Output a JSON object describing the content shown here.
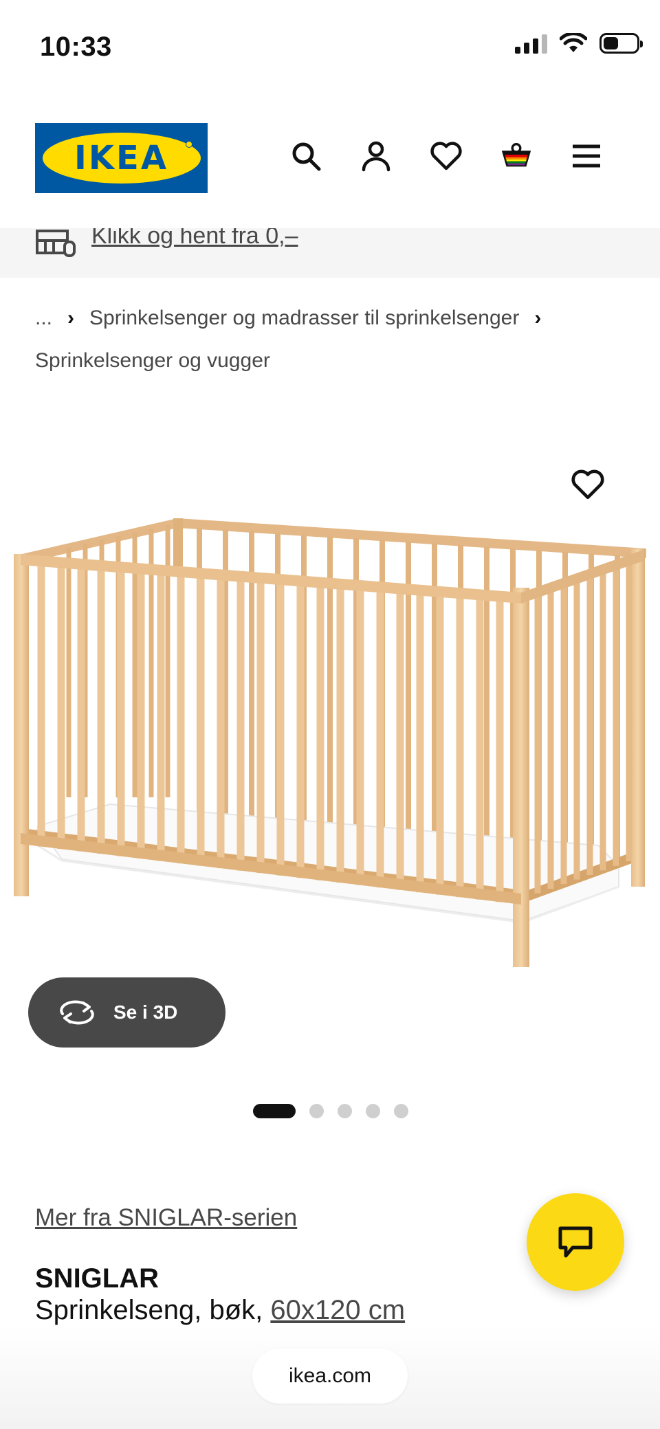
{
  "status_bar": {
    "time": "10:33"
  },
  "header": {
    "logo_text": "IKEA",
    "icons": [
      "search-icon",
      "account-icon",
      "favourites-icon",
      "shopping-bag-icon",
      "menu-icon"
    ]
  },
  "promo": {
    "text": "Klikk og hent fra 0,–",
    "icon": "click-collect-icon"
  },
  "breadcrumb": {
    "ellipsis": "...",
    "items": [
      "Sprinkelsenger og madrasser til sprinkelsenger",
      "Sprinkelsenger og vugger"
    ]
  },
  "gallery": {
    "image_alt": "crib",
    "view_3d_label": "Se i 3D",
    "dots_total": 5,
    "active_dot": 1
  },
  "product": {
    "series_link": "Mer fra SNIGLAR-serien",
    "name": "SNIGLAR",
    "description_prefix": "Sprinkelseng, bøk, ",
    "size_link": "60x120 cm"
  },
  "browser": {
    "url": "ikea.com"
  },
  "colors": {
    "ikea_blue": "#0058a3",
    "ikea_yellow": "#ffdb00",
    "chat_yellow": "#fbd914"
  }
}
